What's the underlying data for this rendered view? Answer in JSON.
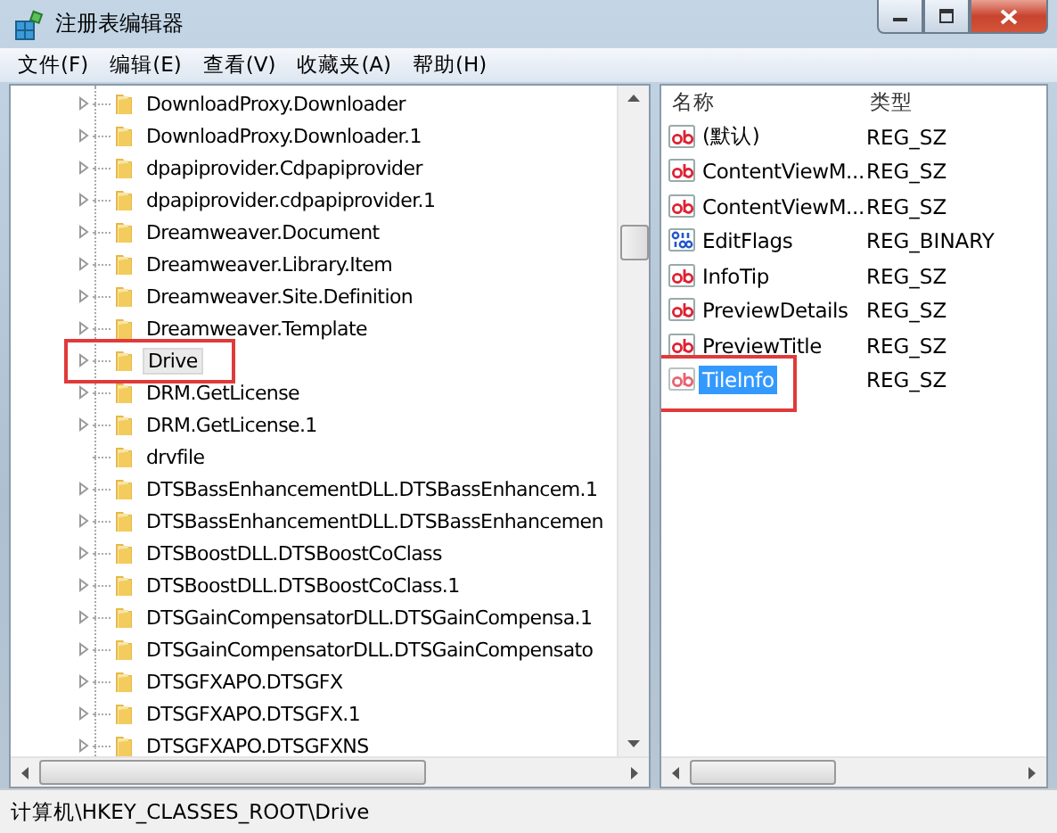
{
  "window": {
    "title": "注册表编辑器"
  },
  "menu": [
    "文件(F)",
    "编辑(E)",
    "查看(V)",
    "收藏夹(A)",
    "帮助(H)"
  ],
  "tree": [
    {
      "label": "DownloadProxy.Downloader",
      "expandable": true,
      "selected": false,
      "marked": false
    },
    {
      "label": "DownloadProxy.Downloader.1",
      "expandable": true,
      "selected": false,
      "marked": false
    },
    {
      "label": "dpapiprovider.Cdpapiprovider",
      "expandable": true,
      "selected": false,
      "marked": false
    },
    {
      "label": "dpapiprovider.cdpapiprovider.1",
      "expandable": true,
      "selected": false,
      "marked": false
    },
    {
      "label": "Dreamweaver.Document",
      "expandable": true,
      "selected": false,
      "marked": false
    },
    {
      "label": "Dreamweaver.Library.Item",
      "expandable": true,
      "selected": false,
      "marked": false
    },
    {
      "label": "Dreamweaver.Site.Definition",
      "expandable": true,
      "selected": false,
      "marked": false
    },
    {
      "label": "Dreamweaver.Template",
      "expandable": true,
      "selected": false,
      "marked": false
    },
    {
      "label": "Drive",
      "expandable": true,
      "selected": true,
      "marked": true
    },
    {
      "label": "DRM.GetLicense",
      "expandable": true,
      "selected": false,
      "marked": false
    },
    {
      "label": "DRM.GetLicense.1",
      "expandable": true,
      "selected": false,
      "marked": false
    },
    {
      "label": "drvfile",
      "expandable": false,
      "selected": false,
      "marked": false
    },
    {
      "label": "DTSBassEnhancementDLL.DTSBassEnhancem.1",
      "expandable": true,
      "selected": false,
      "marked": false
    },
    {
      "label": "DTSBassEnhancementDLL.DTSBassEnhancemen",
      "expandable": true,
      "selected": false,
      "marked": false
    },
    {
      "label": "DTSBoostDLL.DTSBoostCoClass",
      "expandable": true,
      "selected": false,
      "marked": false
    },
    {
      "label": "DTSBoostDLL.DTSBoostCoClass.1",
      "expandable": true,
      "selected": false,
      "marked": false
    },
    {
      "label": "DTSGainCompensatorDLL.DTSGainCompensa.1",
      "expandable": true,
      "selected": false,
      "marked": false
    },
    {
      "label": "DTSGainCompensatorDLL.DTSGainCompensato",
      "expandable": true,
      "selected": false,
      "marked": false
    },
    {
      "label": "DTSGFXAPO.DTSGFX",
      "expandable": true,
      "selected": false,
      "marked": false
    },
    {
      "label": "DTSGFXAPO.DTSGFX.1",
      "expandable": true,
      "selected": false,
      "marked": false
    },
    {
      "label": "DTSGFXAPO.DTSGFXNS",
      "expandable": true,
      "selected": false,
      "marked": false
    }
  ],
  "values": {
    "columns": [
      "名称",
      "类型"
    ],
    "rows": [
      {
        "kind": "string",
        "name": "(默认)",
        "type": "REG_SZ",
        "selected": false,
        "marked": false
      },
      {
        "kind": "string",
        "name": "ContentViewM...",
        "type": "REG_SZ",
        "selected": false,
        "marked": false
      },
      {
        "kind": "string",
        "name": "ContentViewM...",
        "type": "REG_SZ",
        "selected": false,
        "marked": false
      },
      {
        "kind": "binary",
        "name": "EditFlags",
        "type": "REG_BINARY",
        "selected": false,
        "marked": false
      },
      {
        "kind": "string",
        "name": "InfoTip",
        "type": "REG_SZ",
        "selected": false,
        "marked": false
      },
      {
        "kind": "string",
        "name": "PreviewDetails",
        "type": "REG_SZ",
        "selected": false,
        "marked": false
      },
      {
        "kind": "string",
        "name": "PreviewTitle",
        "type": "REG_SZ",
        "selected": false,
        "marked": false
      },
      {
        "kind": "string",
        "name": "TileInfo",
        "type": "REG_SZ",
        "selected": true,
        "marked": true
      }
    ]
  },
  "status_bar": "计算机\\HKEY_CLASSES_ROOT\\Drive"
}
